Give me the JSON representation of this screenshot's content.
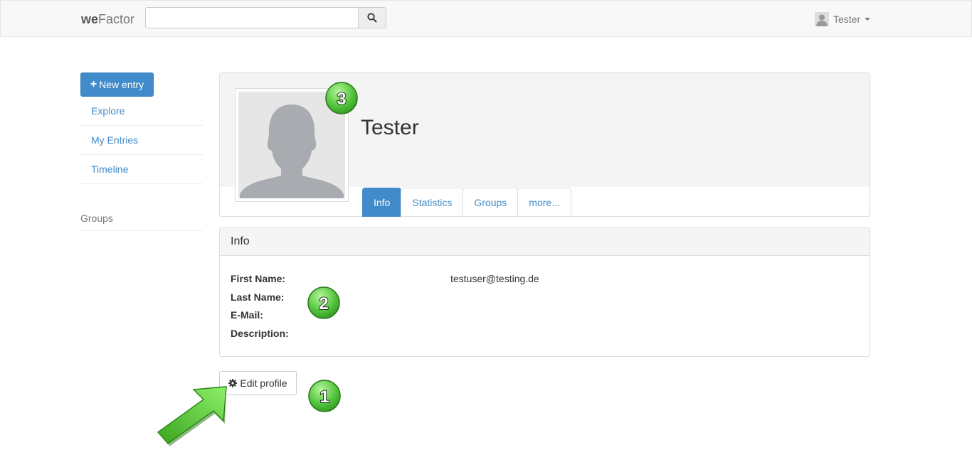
{
  "navbar": {
    "brand_bold": "we",
    "brand_rest": "Factor",
    "search": {
      "value": "",
      "placeholder": ""
    },
    "user_name": "Tester"
  },
  "sidebar": {
    "new_entry_label": "New entry",
    "items": [
      {
        "label": "Explore"
      },
      {
        "label": "My Entries"
      },
      {
        "label": "Timeline"
      }
    ],
    "groups_label": "Groups"
  },
  "profile": {
    "name": "Tester",
    "tabs": [
      {
        "label": "Info",
        "active": true
      },
      {
        "label": "Statistics",
        "active": false
      },
      {
        "label": "Groups",
        "active": false
      },
      {
        "label": "more...",
        "active": false
      }
    ]
  },
  "info": {
    "heading": "Info",
    "fields": [
      {
        "label": "First Name:"
      },
      {
        "label": "Last Name:"
      },
      {
        "label": "E-Mail:"
      },
      {
        "label": "Description:"
      }
    ],
    "email_value": "testuser@testing.de"
  },
  "actions": {
    "edit_profile_label": "Edit profile"
  },
  "annotations": {
    "badges": [
      "1",
      "2",
      "3"
    ],
    "badge_color": "#4fc33a",
    "arrow_color": "#5fd13a"
  },
  "colors": {
    "primary": "#428bca",
    "navbar_bg": "#f8f8f8",
    "header_bg": "#f4f4f4"
  }
}
